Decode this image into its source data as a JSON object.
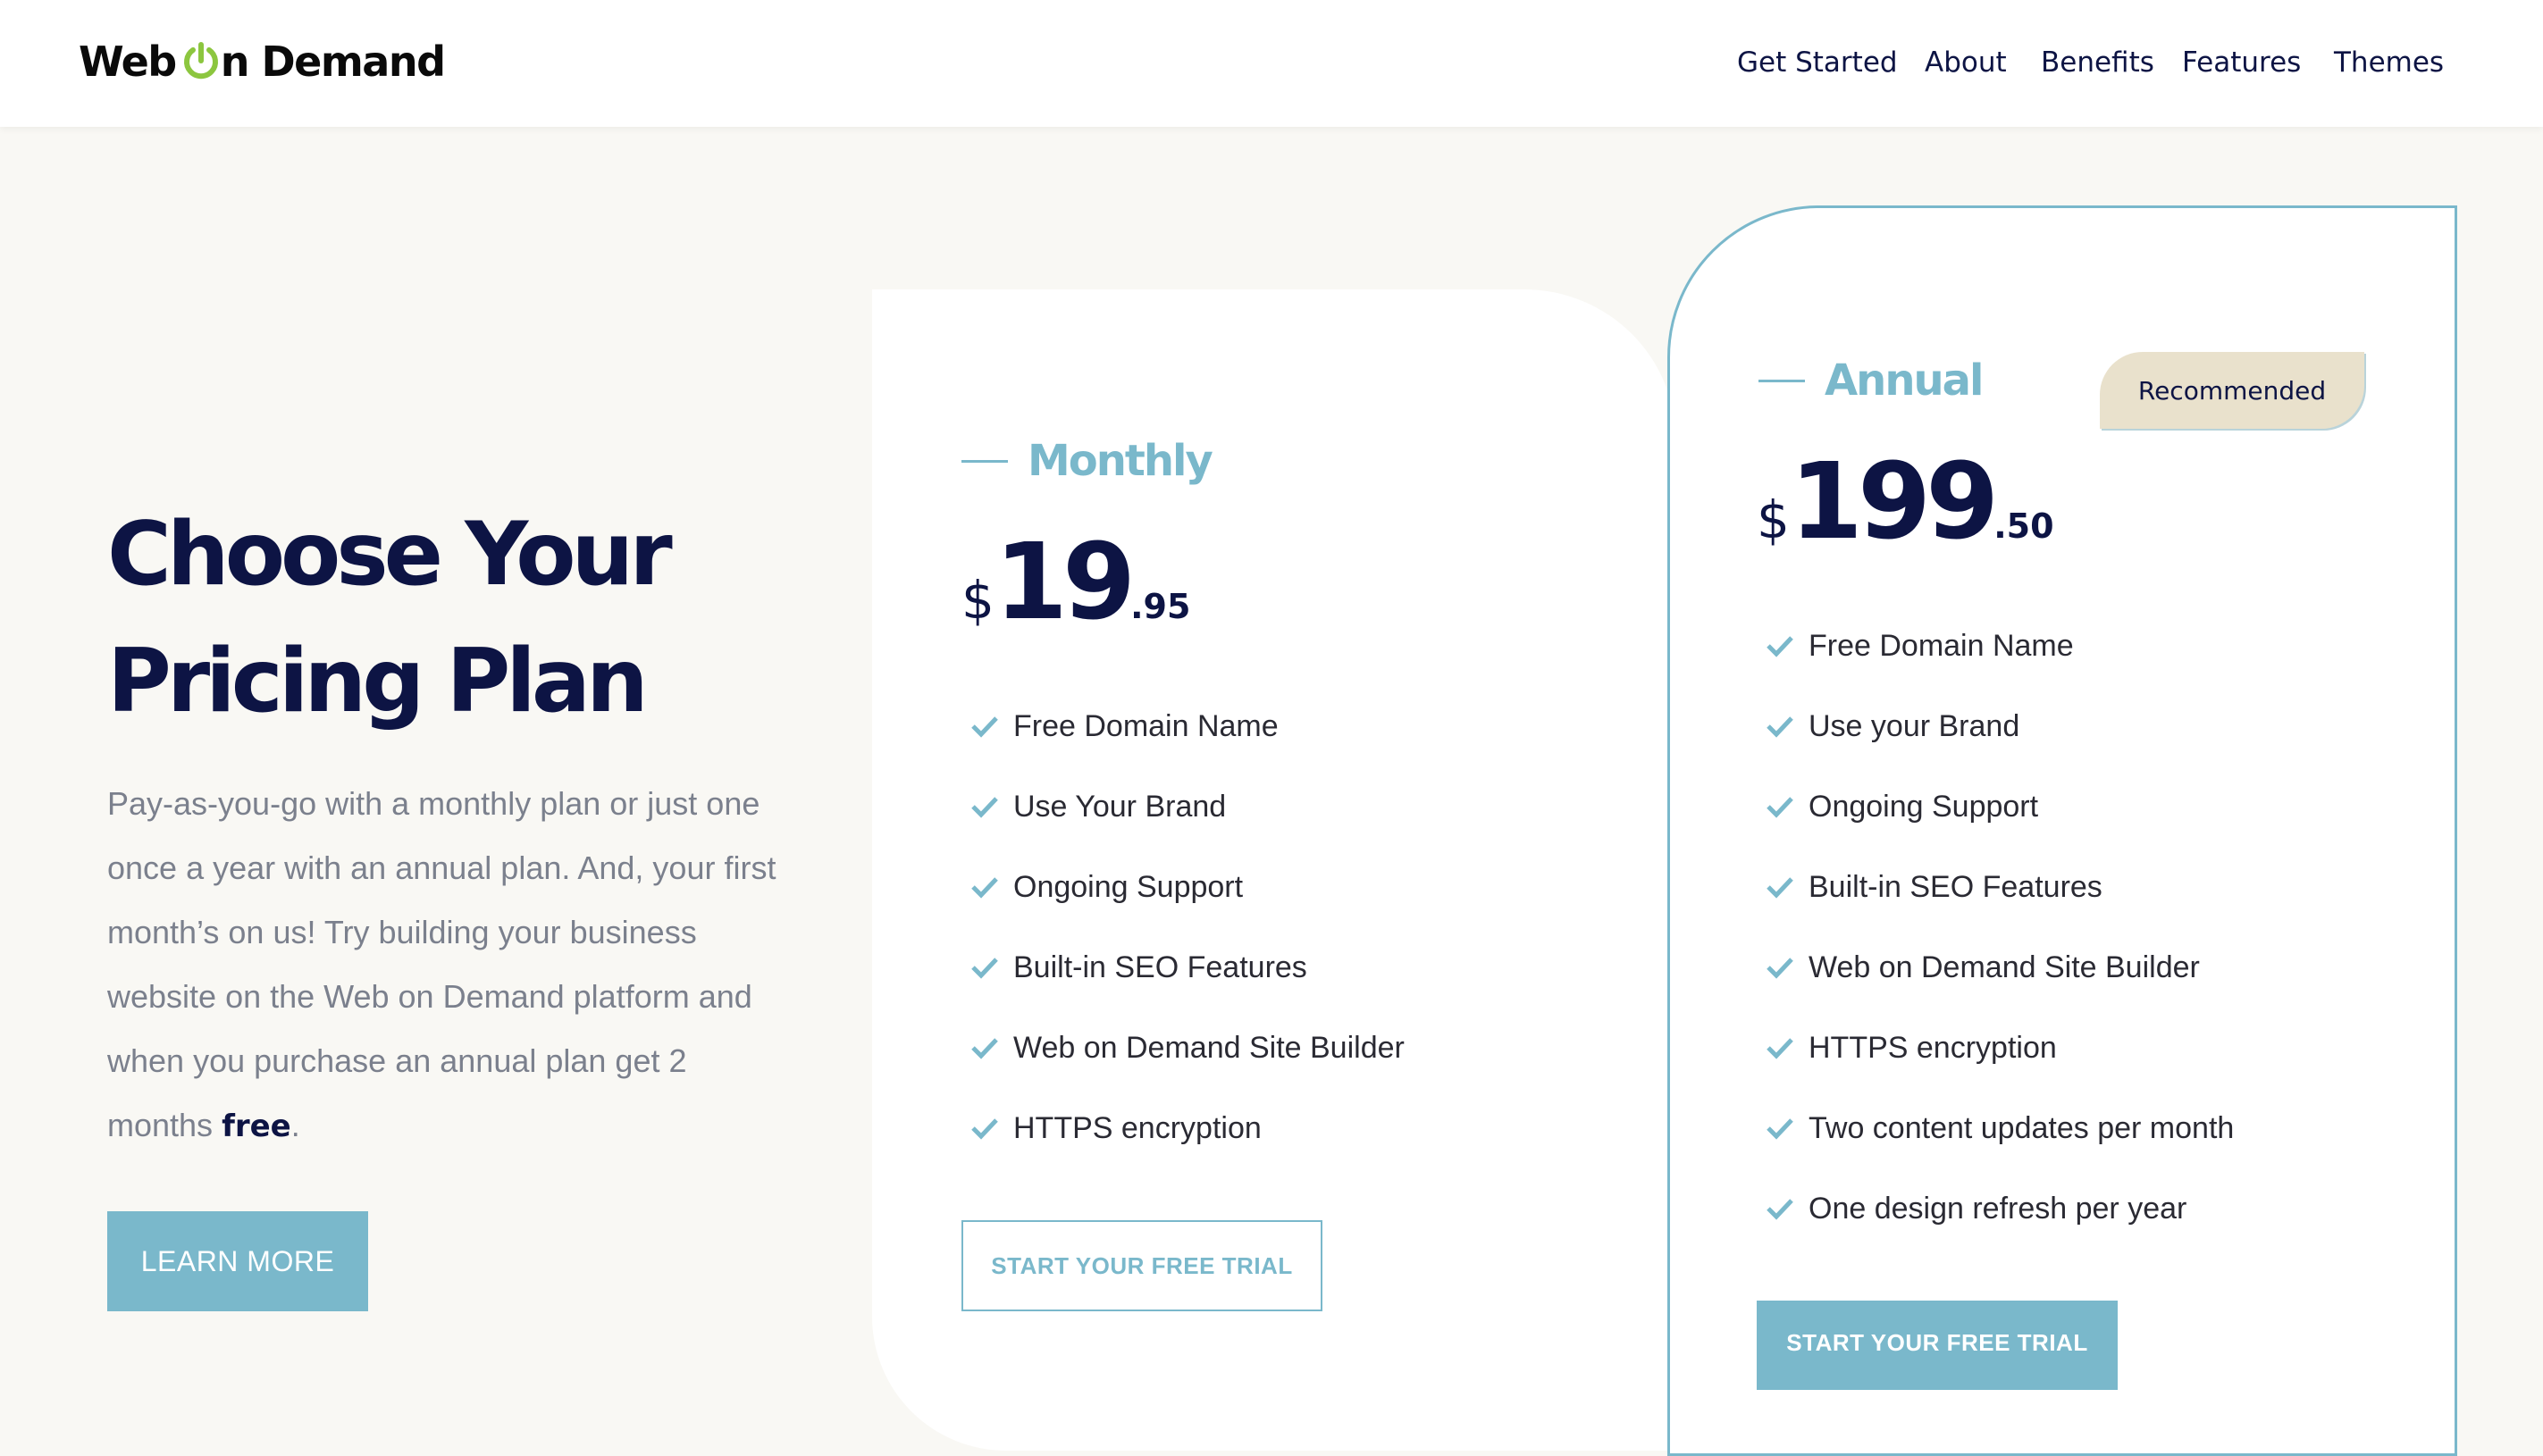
{
  "header": {
    "logo_text_1": "Web ",
    "logo_text_2": "n Demand",
    "logo_icon": "power-icon",
    "nav": [
      "Get Started",
      "About",
      "Benefits",
      "Features",
      "Themes"
    ]
  },
  "hero": {
    "title_line_1": "Choose Your",
    "title_line_2": "Pricing Plan",
    "description": "Pay-as-you-go with a monthly plan or just one once a year with an annual plan. And, your first month’s on us!  Try building your business website on the Web on Demand platform and when you purchase an annual plan get 2 months ",
    "description_bold": "free",
    "description_end": ".",
    "button_label": "LEARN MORE"
  },
  "plans": {
    "monthly": {
      "name": "Monthly",
      "currency": "$",
      "price_main": "19",
      "price_cents": ".95",
      "features": [
        "Free Domain Name",
        "Use Your Brand",
        "Ongoing Support",
        "Built-in SEO Features",
        "Web on Demand Site Builder",
        "HTTPS encryption"
      ],
      "button_label": "START YOUR FREE TRIAL"
    },
    "annual": {
      "name": "Annual",
      "badge": "Recommended",
      "currency": "$",
      "price_main": "199",
      "price_cents": ".50",
      "features": [
        "Free Domain Name",
        "Use your Brand",
        "Ongoing Support",
        "Built-in SEO Features",
        "Web on Demand Site Builder",
        "HTTPS encryption",
        "Two content updates per month",
        "One design refresh per year"
      ],
      "button_label": "START YOUR FREE TRIAL"
    }
  },
  "colors": {
    "accent": "#7ab8cb",
    "navy": "#0d1444",
    "logo_green": "#8cc63f",
    "badge_bg": "#e9e1cc",
    "page_bg": "#f9f8f4"
  },
  "icons": [
    "power-icon",
    "check-icon"
  ]
}
